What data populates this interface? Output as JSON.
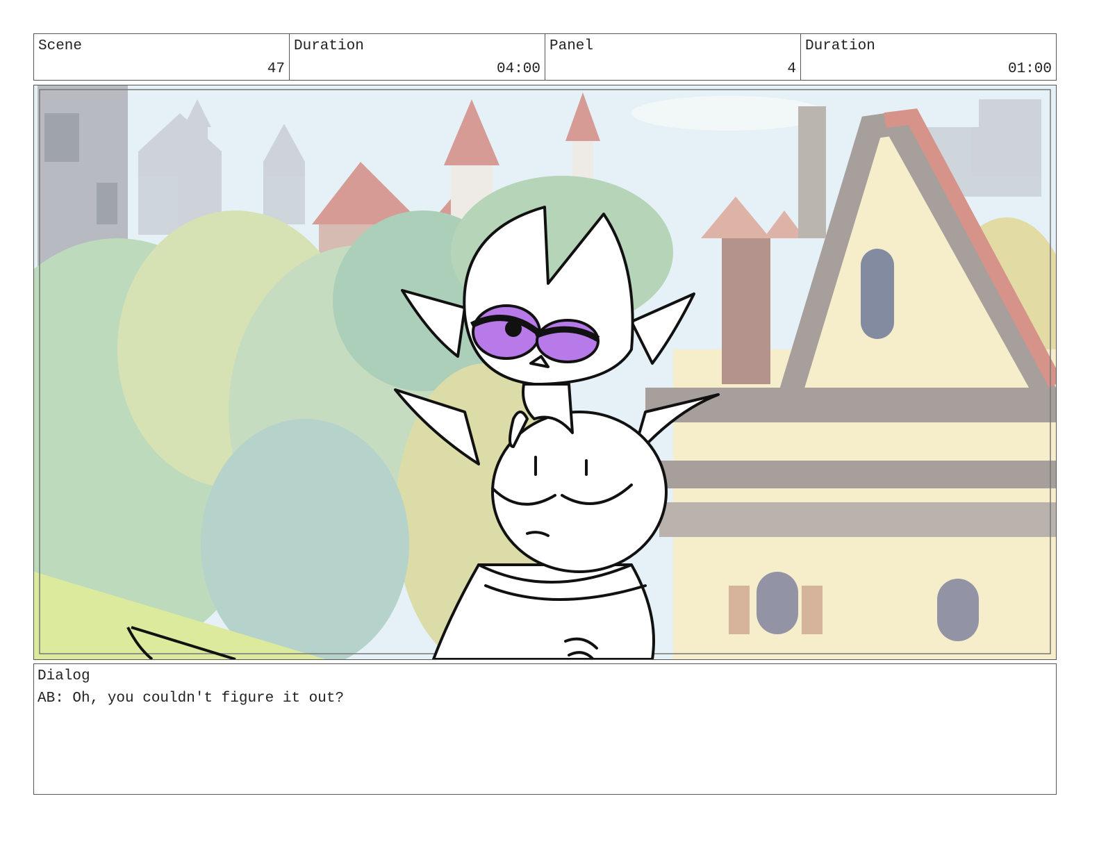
{
  "header": {
    "scene_label": "Scene",
    "scene_value": "47",
    "scene_duration_label": "Duration",
    "scene_duration_value": "04:00",
    "panel_label": "Panel",
    "panel_value": "4",
    "panel_duration_label": "Duration",
    "panel_duration_value": "01:00"
  },
  "dialog": {
    "label": "Dialog",
    "text": "AB: Oh, you couldn't figure it out?"
  },
  "colors": {
    "sky": "#dfeef5",
    "foliage": "#a9cfa4",
    "roof": "#c97a72",
    "house_wall": "#f3e7b8",
    "timber": "#8a7f7a",
    "eye": "#b77ae8",
    "line": "#111111"
  }
}
